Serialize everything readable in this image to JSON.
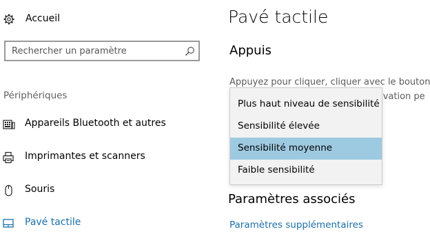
{
  "sidebar": {
    "home_label": "Accueil",
    "search_placeholder": "Rechercher un paramètre",
    "section_title": "Périphériques",
    "items": [
      {
        "label": "Appareils Bluetooth et autres",
        "icon": "keyboard-icon"
      },
      {
        "label": "Imprimantes et scanners",
        "icon": "printer-icon"
      },
      {
        "label": "Souris",
        "icon": "mouse-icon"
      },
      {
        "label": "Pavé tactile",
        "icon": "touchpad-icon",
        "active": true
      }
    ]
  },
  "main": {
    "title": "Pavé tactile",
    "tap_heading": "Appuis",
    "tap_description_line1": "Appuyez pour cliquer, cliquer avec le bouton",
    "tap_description_line2": "tivation pe",
    "related_heading": "Paramètres associés",
    "related_link": "Paramètres supplémentaires"
  },
  "sensitivity_dropdown": {
    "options": [
      "Plus haut niveau de sensibilité",
      "Sensibilité élevée",
      "Sensibilité moyenne",
      "Faible sensibilité"
    ],
    "selected": "Sensibilité moyenne"
  },
  "colors": {
    "accent": "#1a6fa8",
    "selected_option_bg": "#9ecae1",
    "dropdown_bg": "#f2f2f2"
  }
}
